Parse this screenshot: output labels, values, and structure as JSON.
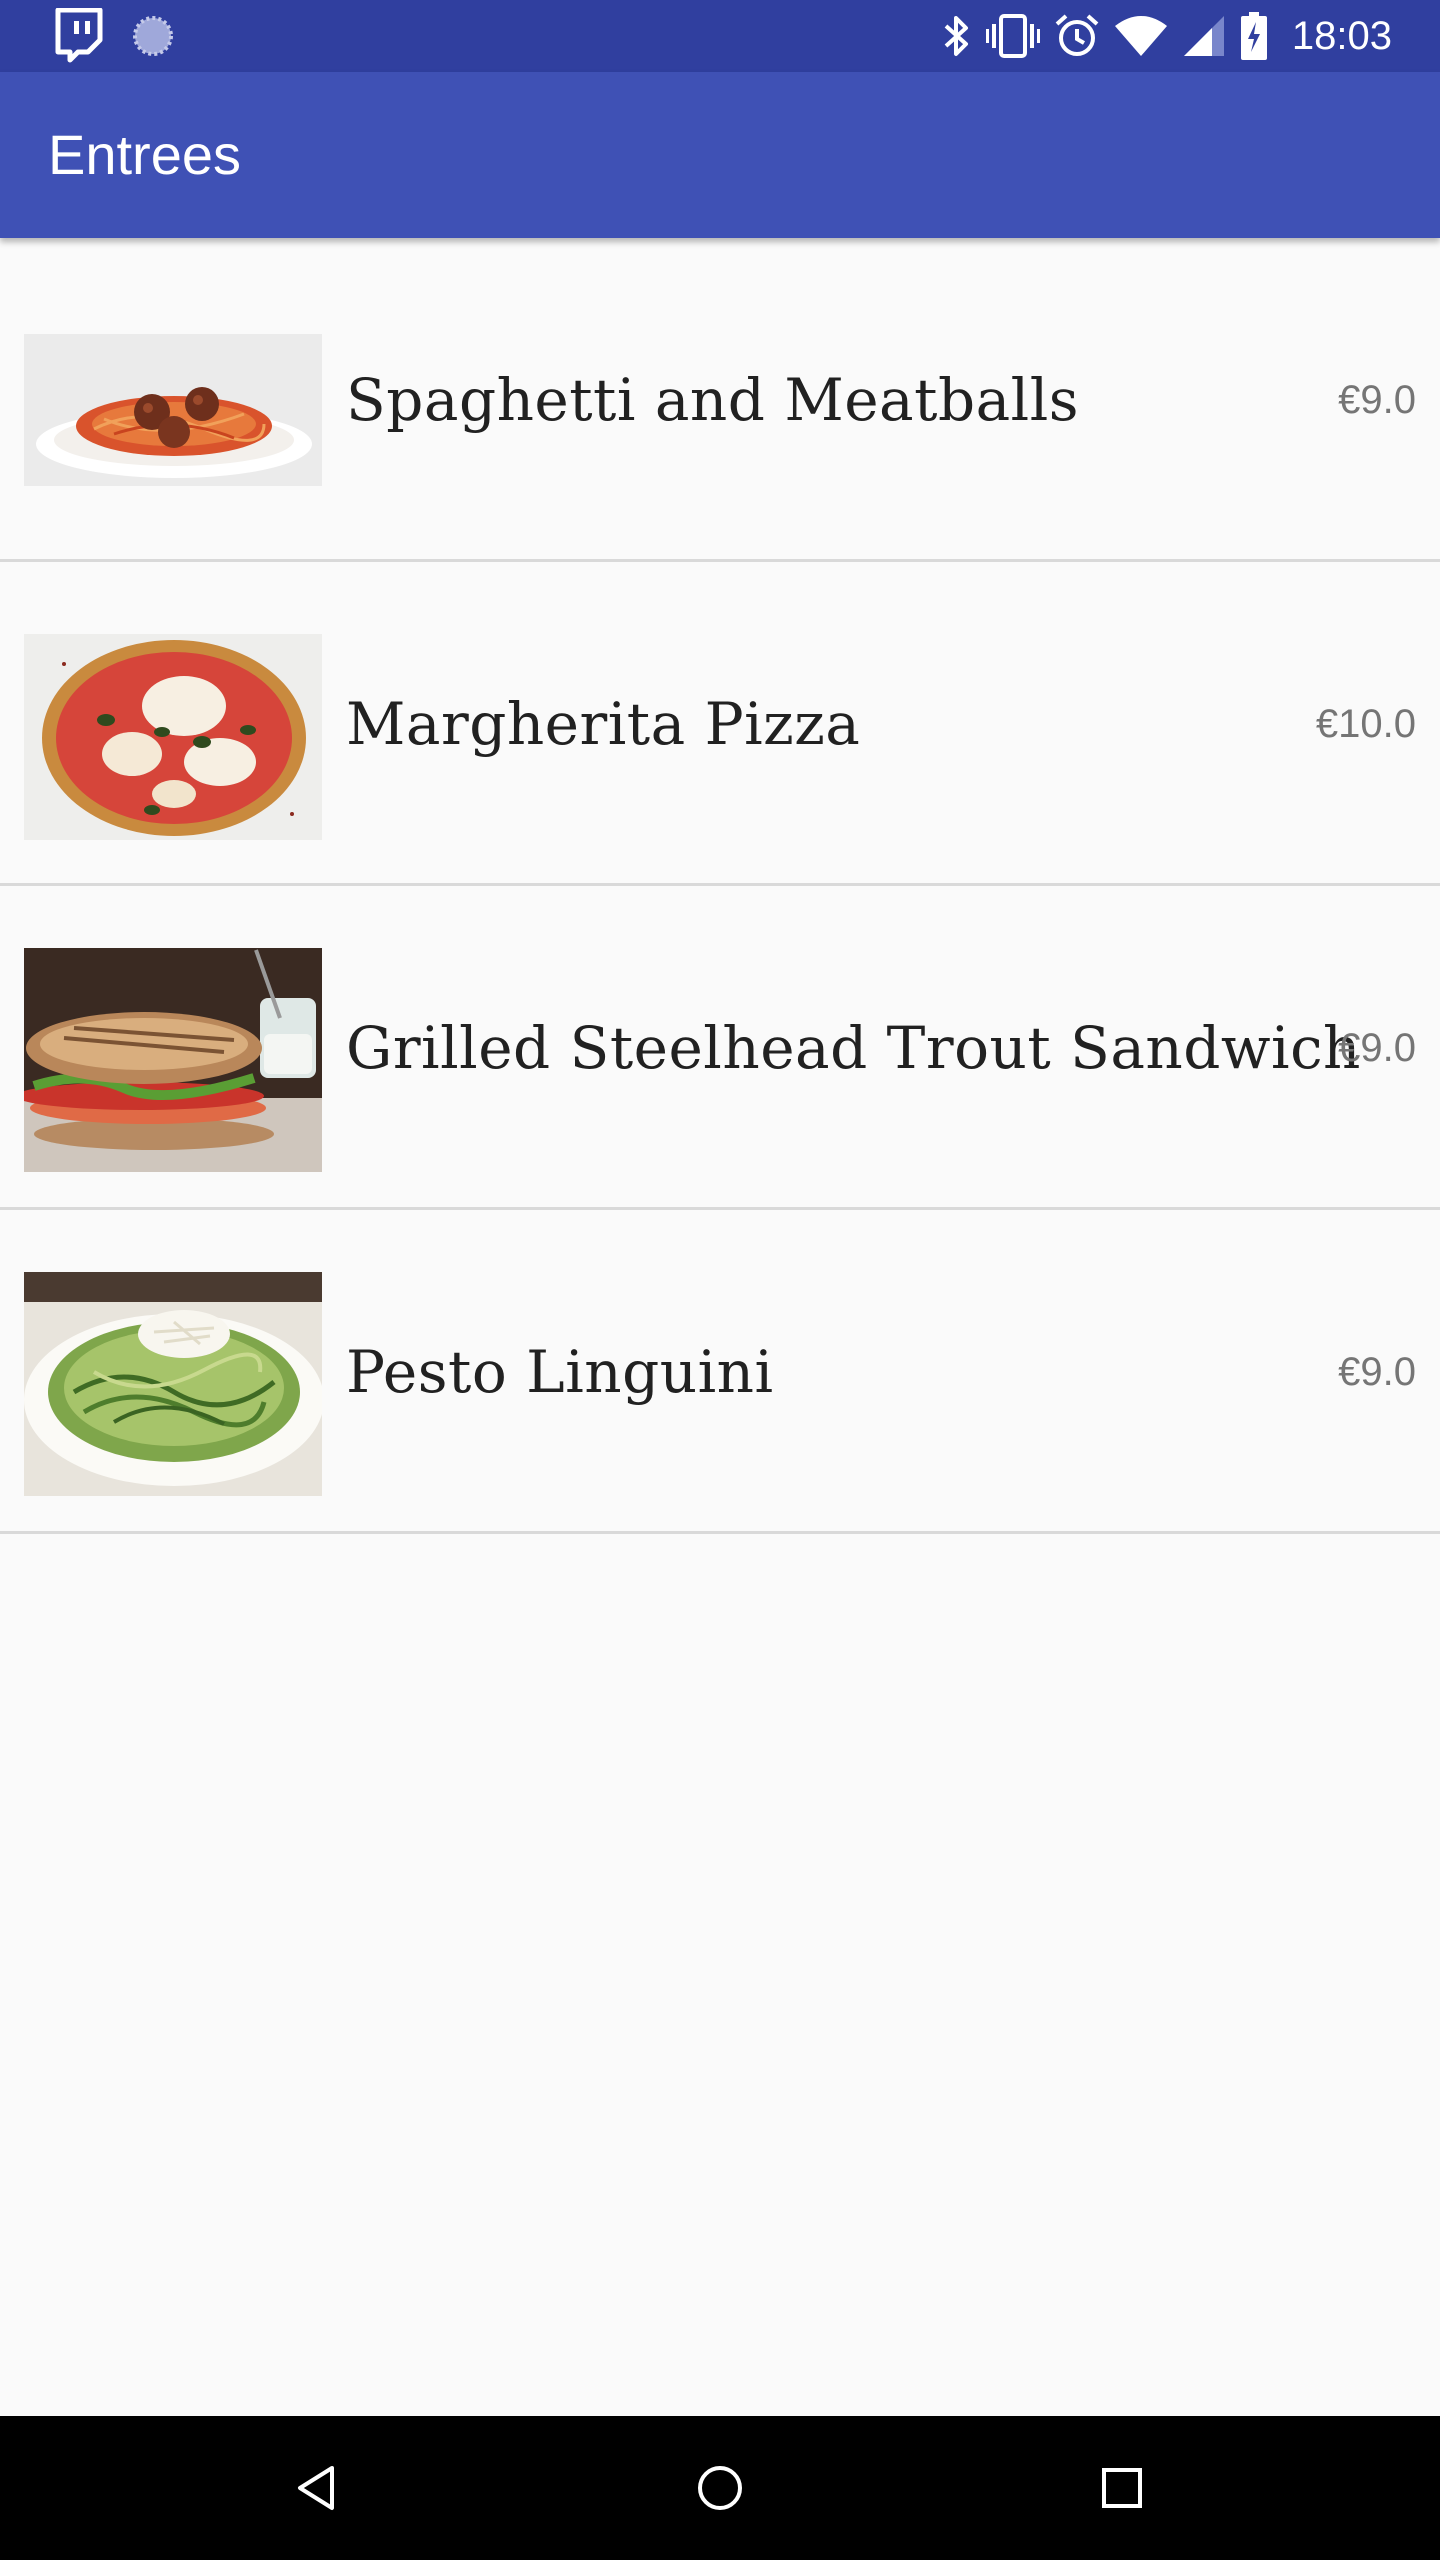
{
  "status_bar": {
    "time": "18:03",
    "left_icons": [
      "twitch-icon",
      "loading-icon"
    ],
    "right_icons": [
      "bluetooth-icon",
      "vibrate-icon",
      "alarm-icon",
      "wifi-icon",
      "signal-icon",
      "battery-charging-icon"
    ]
  },
  "app_bar": {
    "title": "Entrees"
  },
  "menu": {
    "items": [
      {
        "name": "Spaghetti and Meatballs",
        "price": "€9.0",
        "image": "spaghetti-photo"
      },
      {
        "name": "Margherita Pizza",
        "price": "€10.0",
        "image": "pizza-photo"
      },
      {
        "name": "Grilled Steelhead Trout Sandwich",
        "price": "€9.0",
        "image": "sandwich-photo"
      },
      {
        "name": "Pesto Linguini",
        "price": "€9.0",
        "image": "pesto-photo"
      }
    ]
  },
  "nav_bar": {
    "buttons": [
      "back-icon",
      "home-icon",
      "recents-icon"
    ]
  },
  "colors": {
    "status_bar": "#303f9f",
    "app_bar": "#3f51b5",
    "background": "#fafafa",
    "divider": "#d9d9d9",
    "price_text": "#757575",
    "nav_bar": "#000000"
  }
}
